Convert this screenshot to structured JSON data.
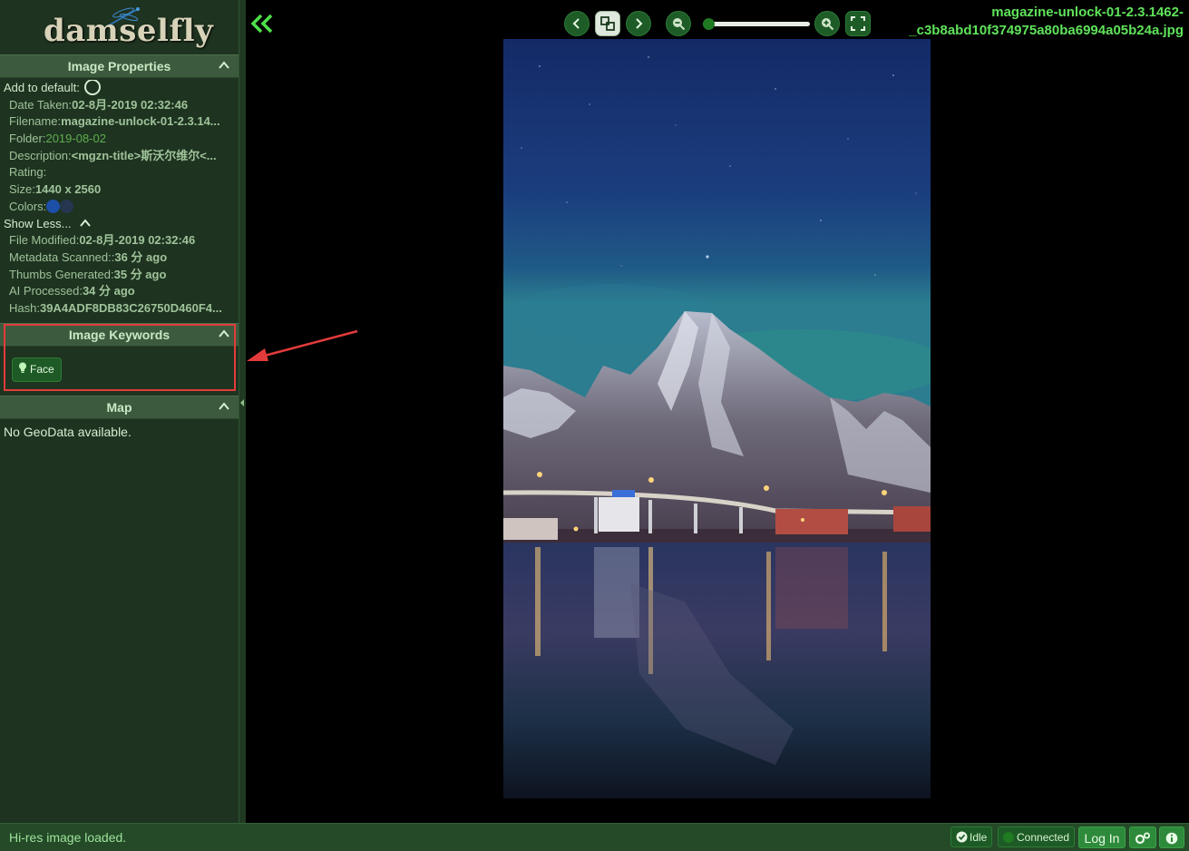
{
  "app": {
    "logo_text": "damselfly"
  },
  "properties_panel": {
    "title": "Image Properties",
    "add_to_default_label": "Add to default:",
    "rows_top": [
      {
        "label": "Date Taken:",
        "value": "02-8月-2019 02:32:46"
      },
      {
        "label": "Filename:",
        "value": "magazine-unlock-01-2.3.14..."
      },
      {
        "label": "Folder:",
        "value": "2019-08-02"
      },
      {
        "label": "Description:",
        "value": "<mgzn-title>斯沃尔维尔<..."
      },
      {
        "label": "Rating:",
        "value": ""
      },
      {
        "label": "Size:",
        "value": "1440 x 2560"
      },
      {
        "label": "Colors:",
        "value": ""
      }
    ],
    "colors": [
      "#1e4fa8",
      "#263650"
    ],
    "show_less_label": "Show Less...",
    "rows_more": [
      {
        "label": "File Modified:",
        "value": "02-8月-2019 02:32:46"
      },
      {
        "label": "Metadata Scanned::",
        "value": "36 分 ago"
      },
      {
        "label": "Thumbs Generated:",
        "value": "35 分 ago"
      },
      {
        "label": "AI Processed:",
        "value": "34 分 ago"
      },
      {
        "label": "Hash:",
        "value": "39A4ADF8DB83C26750D460F4..."
      }
    ]
  },
  "keywords_panel": {
    "title": "Image Keywords",
    "keywords": [
      {
        "label": "Face",
        "icon": "lightbulb-icon"
      }
    ]
  },
  "map_panel": {
    "title": "Map",
    "empty_text": "No GeoData available."
  },
  "viewer": {
    "file_title_line1": "magazine-unlock-01-2.3.1462-",
    "file_title_line2": "_c3b8abd10f374975a80ba6994a05b24a.jpg",
    "zoom_level": 0.0
  },
  "status_bar": {
    "message": "Hi-res image loaded.",
    "idle_label": "Idle",
    "connected_label": "Connected",
    "login_label": "Log In"
  },
  "colors": {
    "accent_green": "#5fe35a",
    "sidebar_bg": "#1e3320",
    "header_bg": "#3c5a3d",
    "highlight_red": "#e33b3b"
  }
}
